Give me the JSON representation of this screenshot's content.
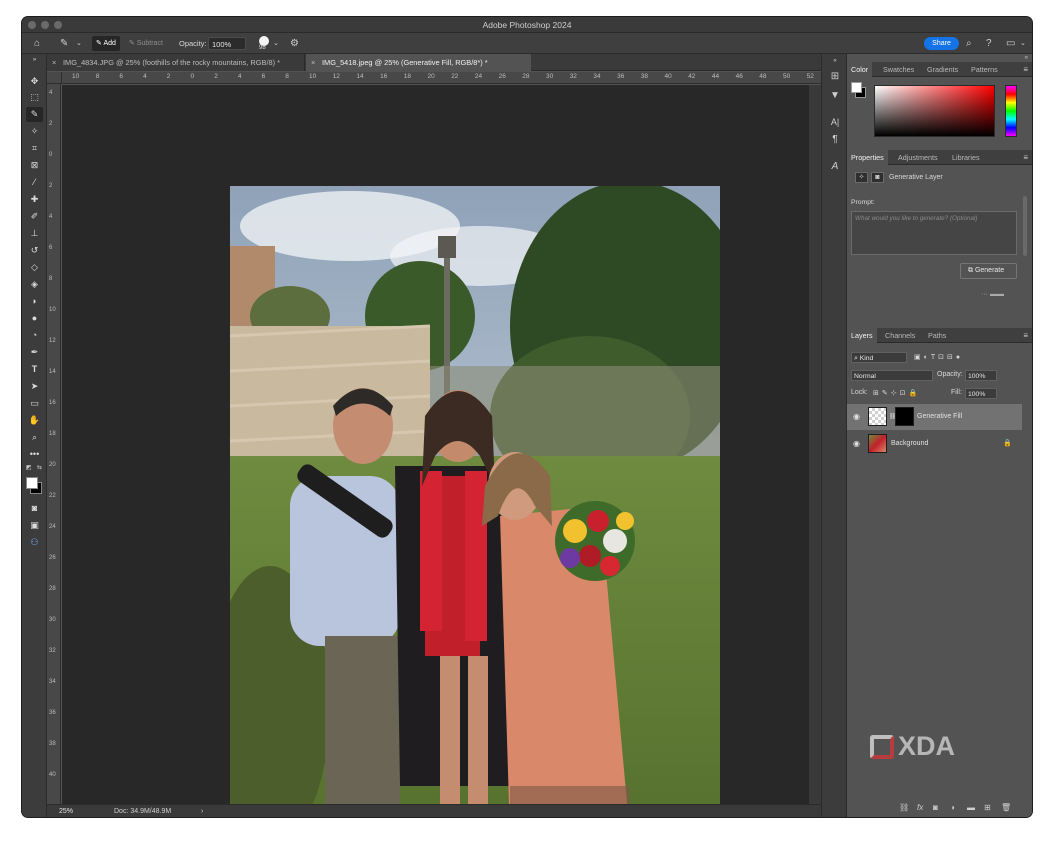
{
  "app": {
    "title": "Adobe Photoshop 2024"
  },
  "options_bar": {
    "home_icon": "home-icon",
    "tool_icon": "brush-tool-icon",
    "add_label": "Add",
    "subtract_label": "Subtract",
    "opacity_label": "Opacity:",
    "opacity_value": "100%",
    "brush_size": "98",
    "share_label": "Share"
  },
  "tabs": [
    {
      "label": "IMG_4834.JPG @ 25% (foothills of the rocky mountains, RGB/8) *",
      "active": false
    },
    {
      "label": "IMG_5418.jpeg @ 25% (Generative Fill, RGB/8*) *",
      "active": true
    }
  ],
  "ruler_top": [
    "10",
    "8",
    "6",
    "4",
    "2",
    "0",
    "2",
    "4",
    "6",
    "8",
    "10",
    "12",
    "14",
    "16",
    "18",
    "20",
    "22",
    "24",
    "26",
    "28",
    "30",
    "32",
    "34",
    "36",
    "38",
    "40",
    "42",
    "44",
    "46",
    "48",
    "50",
    "52"
  ],
  "ruler_left": [
    "4",
    "2",
    "0",
    "2",
    "4",
    "6",
    "8",
    "10",
    "12",
    "14",
    "16",
    "18",
    "20",
    "22",
    "24",
    "26",
    "28",
    "30",
    "32",
    "34",
    "36",
    "38",
    "40"
  ],
  "status": {
    "zoom": "25%",
    "doc": "Doc: 34.9M/48.9M",
    "arrow": "›"
  },
  "color_panel": {
    "tabs": [
      "Color",
      "Swatches",
      "Gradients",
      "Patterns"
    ]
  },
  "properties_panel": {
    "tabs": [
      "Properties",
      "Adjustments",
      "Libraries"
    ],
    "layer_type": "Generative Layer",
    "prompt_label": "Prompt:",
    "prompt_placeholder": "What would you like to generate? (Optional)",
    "generate_label": "Generate"
  },
  "layers_panel": {
    "tabs": [
      "Layers",
      "Channels",
      "Paths"
    ],
    "filter_label": "Kind",
    "blend_mode": "Normal",
    "opacity_label": "Opacity:",
    "opacity_value": "100%",
    "lock_label": "Lock:",
    "fill_label": "Fill:",
    "fill_value": "100%",
    "layers": [
      {
        "name": "Generative Fill",
        "selected": true
      },
      {
        "name": "Background",
        "selected": false
      }
    ]
  },
  "watermark": "XDA"
}
